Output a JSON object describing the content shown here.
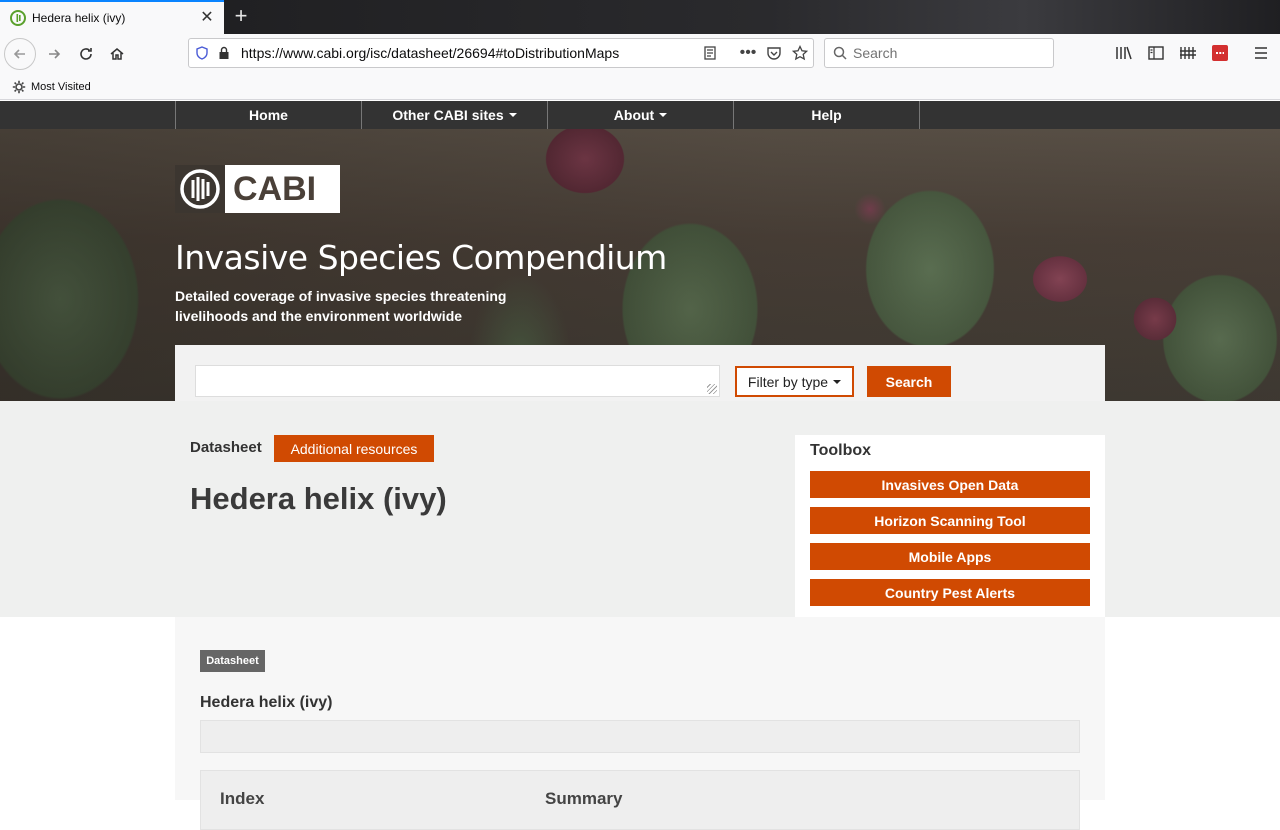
{
  "browser": {
    "tab_title": "Hedera helix (ivy)",
    "new_tab": "+",
    "url": "https://www.cabi.org/isc/datasheet/26694#toDistributionMaps",
    "search_placeholder": "Search",
    "bookmark": "Most Visited",
    "accent": "#0a84ff"
  },
  "site_nav": {
    "items": [
      {
        "label": "Home",
        "dropdown": false
      },
      {
        "label": "Other CABI sites",
        "dropdown": true
      },
      {
        "label": "About",
        "dropdown": true
      },
      {
        "label": "Help",
        "dropdown": false
      }
    ]
  },
  "hero": {
    "logo_text": "CABI",
    "title": "Invasive Species Compendium",
    "subtitle": "Detailed coverage of invasive species threatening livelihoods and the environment worldwide"
  },
  "search": {
    "query": "",
    "filter_label": "Filter by type",
    "button_label": "Search"
  },
  "page": {
    "tab_datasheet": "Datasheet",
    "tab_additional": "Additional resources",
    "species_title": "Hedera helix (ivy)"
  },
  "toolbox": {
    "title": "Toolbox",
    "buttons": [
      "Invasives Open Data",
      "Horizon Scanning Tool",
      "Mobile Apps",
      "Country Pest Alerts"
    ]
  },
  "datasheet": {
    "badge": "Datasheet",
    "heading": "Hedera helix (ivy)",
    "col_index": "Index",
    "col_summary": "Summary"
  },
  "colors": {
    "brand_orange": "#d04a02",
    "nav_dark": "#333333"
  }
}
